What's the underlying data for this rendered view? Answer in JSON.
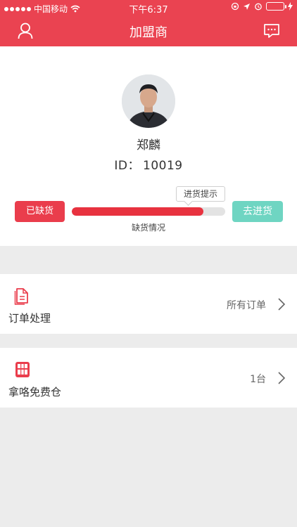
{
  "status_bar": {
    "carrier": "中国移动",
    "time": "下午6:37"
  },
  "nav": {
    "title": "加盟商",
    "left_icon": "user-icon",
    "right_icon": "message-icon"
  },
  "profile": {
    "name": "郑麟",
    "id_label": "ID：",
    "id_value": "10019",
    "avatar_icon": "avatar-photo"
  },
  "stock": {
    "shortage_button": "已缺货",
    "restock_button": "去进货",
    "tip_text": "进货提示",
    "bar_caption": "缺货情况",
    "bar_level": 0.86,
    "colors": {
      "danger": "#ea3d4c",
      "teal": "#6fd5c2"
    }
  },
  "list": {
    "rows": [
      {
        "label": "订单处理",
        "value": "所有订单",
        "icon": "document-icon"
      },
      {
        "label": "拿咯免费仓",
        "value": "1台",
        "icon": "cabinet-icon"
      }
    ]
  },
  "theme": {
    "primary": "#ea4351",
    "background": "#ececec"
  }
}
